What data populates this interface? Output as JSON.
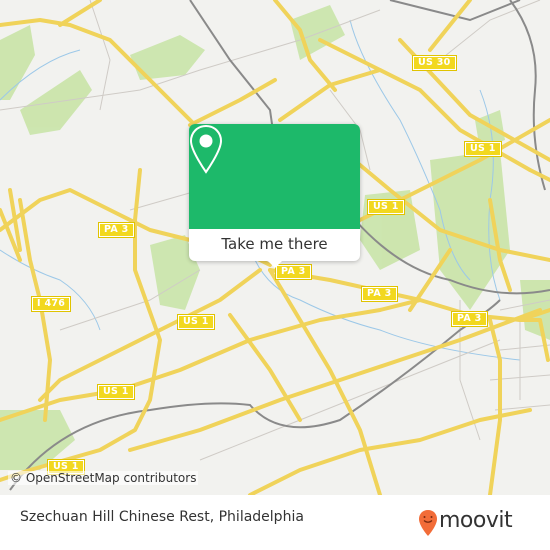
{
  "map": {
    "shields": [
      {
        "label": "US 30",
        "road": "us-30"
      },
      {
        "label": "US 1",
        "road": "us-1"
      },
      {
        "label": "US 1",
        "road": "us-1"
      },
      {
        "label": "PA 3",
        "road": "pa-3"
      },
      {
        "label": "PA 3",
        "road": "pa-3"
      },
      {
        "label": "PA 3",
        "road": "pa-3"
      },
      {
        "label": "PA 3",
        "road": "pa-3"
      },
      {
        "label": "I 476",
        "road": "i-476"
      },
      {
        "label": "US 1",
        "road": "us-1"
      },
      {
        "label": "US 1",
        "road": "us-1"
      },
      {
        "label": "US 1",
        "road": "us-1"
      }
    ],
    "attribution": "© OpenStreetMap contributors",
    "colors": {
      "background": "#f2f2ef",
      "road": "#f7e27a",
      "park": "#c9e4a8",
      "water": "#9cc8e8",
      "rail": "#888888"
    }
  },
  "popup": {
    "icon": "map-pin-icon",
    "button_label": "Take me there",
    "color": "#1db96a"
  },
  "footer": {
    "place_name": "Szechuan Hill Chinese Rest, Philadelphia",
    "brand": "moovit",
    "brand_color": "#f26c38"
  }
}
